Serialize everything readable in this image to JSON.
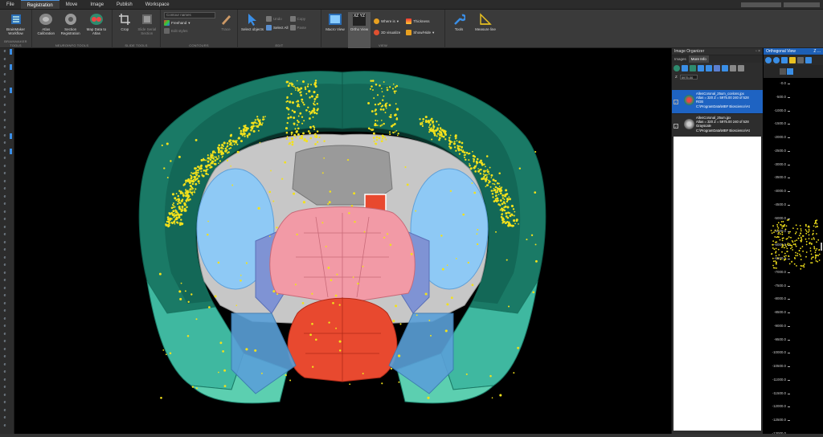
{
  "menubar": {
    "items": [
      "File",
      "Registration",
      "Move",
      "Image",
      "Publish",
      "Workspace"
    ],
    "active_index": 1
  },
  "ribbon": {
    "workflow": {
      "label": "BrainMaker Workflow",
      "group": "BRAINMAKER TOOLS"
    },
    "neuroinfo": {
      "group": "NEUROINFO TOOLS",
      "buttons": [
        "Atlas Calibration",
        "Section Registration",
        "Map Data to Atlas"
      ]
    },
    "slide": {
      "group": "SLIDE TOOLS",
      "buttons": [
        "Crop",
        "Slide Serial Section"
      ]
    },
    "contours": {
      "group": "CONTOURS",
      "search_placeholder": "Contour names",
      "freehand_label": "Freehand",
      "edit_label": "Edit styles",
      "trace_label": "Trace"
    },
    "edit": {
      "group": "EDIT",
      "select_label": "Select objects",
      "undo_label": "Undo",
      "select_all_label": "Select All",
      "copy_label": "Copy",
      "paste_label": "Paste"
    },
    "view": {
      "group": "VIEW",
      "macro_label": "Macro View",
      "ortho_label": "Ortho View",
      "ortho_glyph": "XZ YZ",
      "where_label": "Where is",
      "thickness_label": "Thickness",
      "visualize_label": "3D visualize",
      "showhide_label": "Show/Hide"
    },
    "tools": {
      "tools_label": "Tools",
      "measure_label": "Measure line"
    }
  },
  "leftbar": {
    "marker": "e",
    "count": 50,
    "blue_rows": [
      0,
      2,
      5,
      11,
      13
    ]
  },
  "organizer": {
    "title": "Image Organizer",
    "tabs": [
      "Images",
      "More Info"
    ],
    "z_label": "Z",
    "z_value": "5975.00",
    "images": [
      {
        "name": "AllenCoronal_25um_ccelons.jpx",
        "line2": "Atlas = 320  Z = 5975.00   240 of 528",
        "line3": "RGB",
        "line4": "C:\\ProgramData\\MBF Bioscience\\At"
      },
      {
        "name": "AllenCoronal_25um.jpx",
        "line2": "Atlas = 320  Z = 5975.00   240 of 528",
        "line3": "Grayscale",
        "line4": "C:\\ProgramData\\MBF Bioscience\\At"
      }
    ]
  },
  "ortho": {
    "title": "Orthogonal View",
    "title_right": "Z ...",
    "ticks": [
      "-0.0",
      "-500.0",
      "-1000.0",
      "-1500.0",
      "-2000.0",
      "-2500.0",
      "-3000.0",
      "-3500.0",
      "-4000.0",
      "-4500.0",
      "-5000.0",
      "-5500.0",
      "-6000.0",
      "-6500.0",
      "-7000.0",
      "-7500.0",
      "-8000.0",
      "-8500.0",
      "-9000.0",
      "-9500.0",
      "-10000.0",
      "-10500.0",
      "-11000.0",
      "-11500.0",
      "-12000.0",
      "-12500.0",
      "-13000.0"
    ]
  },
  "colors": {
    "cortex": "#1a7a66",
    "cortex_dark": "#0f5a4a",
    "striatum": "#8ec9f5",
    "thalamus": "#f29aa6",
    "hypothalamus": "#e8492f",
    "fiber": "#c7c7c7",
    "ventricle": "#8a8a8a",
    "accent": "#1e63c2",
    "dots": "#f2e11c"
  }
}
